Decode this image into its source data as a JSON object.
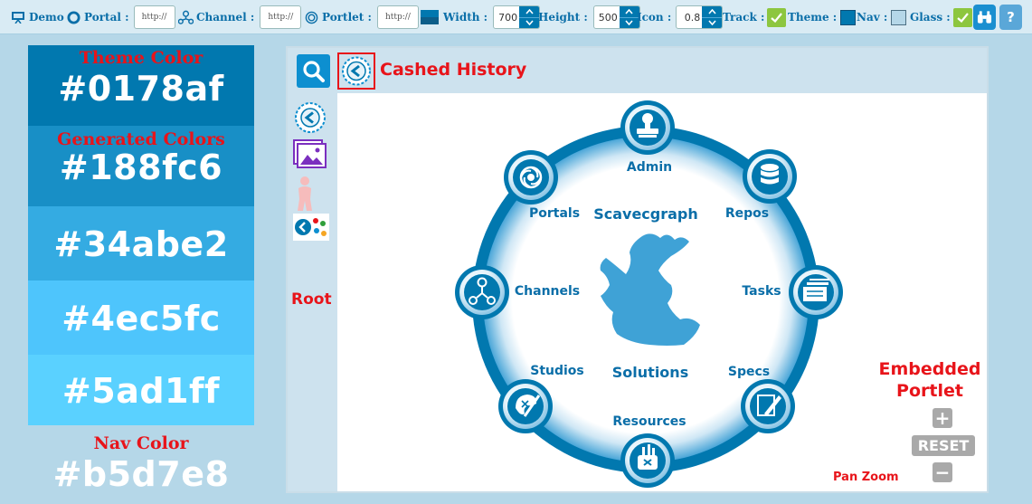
{
  "toolbar": {
    "demo_label": "Demo",
    "portal_label": "Portal :",
    "portal_value": "http://",
    "channel_label": "Channel :",
    "channel_value": "http://",
    "portlet_label": "Portlet :",
    "portlet_value": "http://",
    "width_label": "Width :",
    "width_value": "700",
    "height_label": "Height :",
    "height_value": "500",
    "icon_label": "Icon :",
    "icon_value": "0.8",
    "track_label": "Track :",
    "track_checked": true,
    "theme_label": "Theme :",
    "nav_label": "Nav :",
    "glass_label": "Glass :",
    "glass_checked": true,
    "help_label": "?",
    "icons": [
      "presentation-icon",
      "portal-ring-icon",
      "channel-hub-icon",
      "portlet-swirl-icon",
      "binoculars-icon",
      "help-icon"
    ]
  },
  "colors": {
    "theme_label": "Theme Color",
    "theme_hex": "#0178af",
    "generated_label": "Generated Colors",
    "generated": [
      "#188fc6",
      "#34abe2",
      "#4ec5fc",
      "#5ad1ff"
    ],
    "nav_label": "Nav Color",
    "nav_hex": "#b5d7e8"
  },
  "portlet": {
    "history_title": "Cashed History",
    "root_label": "Root",
    "side_icons": [
      "history-icon",
      "image-icon",
      "figure-icon",
      "root-thumbnail-icon"
    ],
    "wheel": {
      "top_title": "Scavecgraph",
      "bottom_title": "Solutions",
      "nodes": [
        {
          "label": "Admin",
          "icon": "stamp-icon"
        },
        {
          "label": "Repos",
          "icon": "database-icon"
        },
        {
          "label": "Tasks",
          "icon": "document-stack-icon"
        },
        {
          "label": "Specs",
          "icon": "edit-document-icon"
        },
        {
          "label": "Resources",
          "icon": "toolbox-icon"
        },
        {
          "label": "Studios",
          "icon": "palette-brush-icon"
        },
        {
          "label": "Channels",
          "icon": "channel-hub-icon"
        },
        {
          "label": "Portals",
          "icon": "portal-swirl-icon"
        }
      ]
    },
    "embedded_label": "Embedded Portlet",
    "zoom_in": "+",
    "reset_label": "RESET",
    "zoom_out": "−",
    "panzoom_label": "Pan Zoom"
  }
}
